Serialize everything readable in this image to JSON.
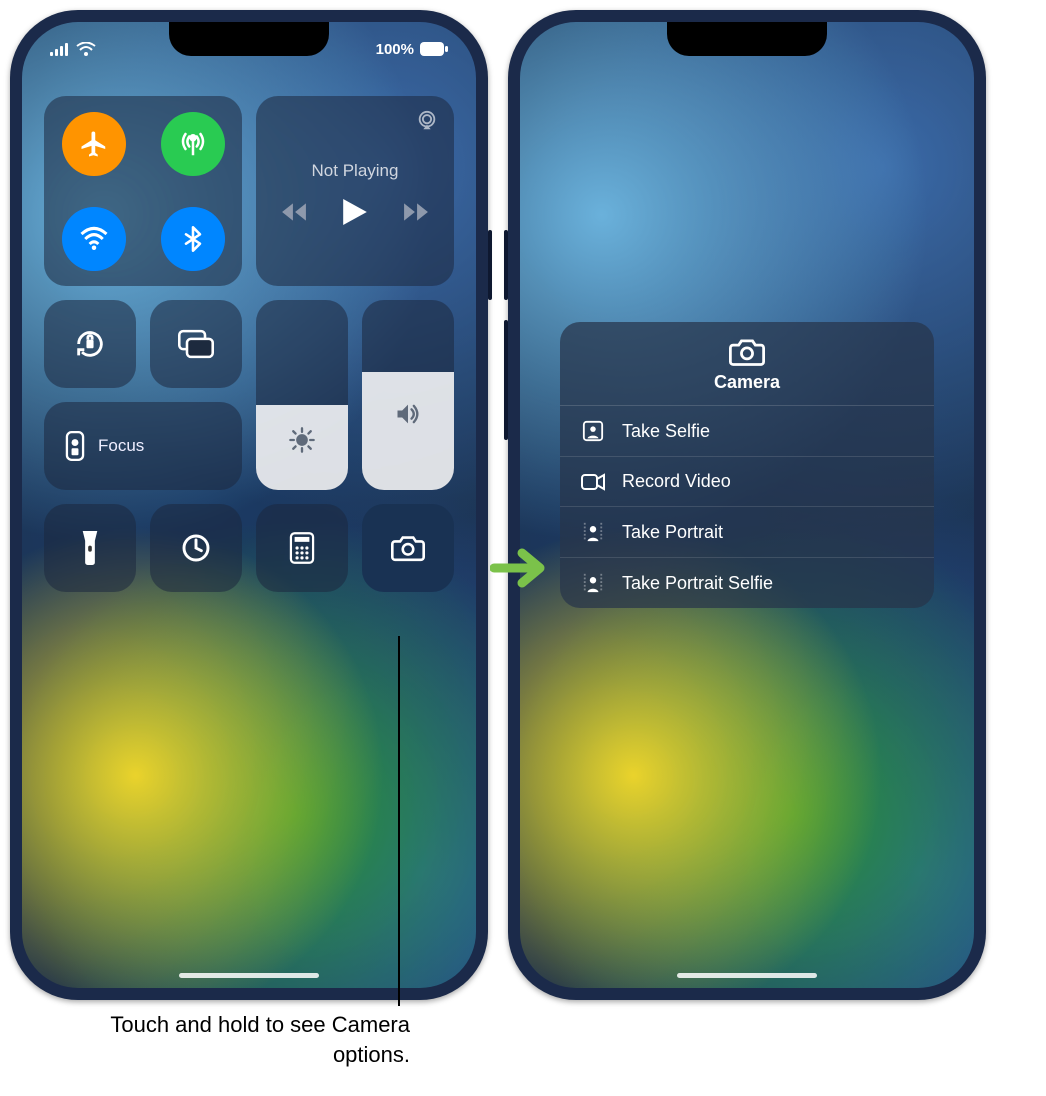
{
  "status": {
    "battery": "100%"
  },
  "music": {
    "state": "Not Playing"
  },
  "focus": {
    "label": "Focus"
  },
  "brightness": {
    "level_pct": 45
  },
  "volume": {
    "level_pct": 62
  },
  "camera_menu": {
    "title": "Camera",
    "items": [
      "Take Selfie",
      "Record Video",
      "Take Portrait",
      "Take Portrait Selfie"
    ]
  },
  "callout": "Touch and hold to see Camera options."
}
